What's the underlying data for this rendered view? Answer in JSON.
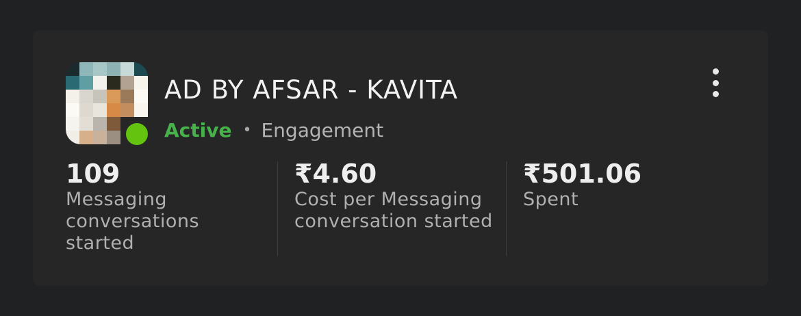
{
  "ad": {
    "title": "AD BY AFSAR - KAVITA",
    "status": "Active",
    "separator": "•",
    "objective": "Engagement",
    "status_color": "#63c30f"
  },
  "metrics": [
    {
      "value": "109",
      "label": "Messaging conversations started"
    },
    {
      "value": "₹4.60",
      "label": "Cost per Messaging conversation started"
    },
    {
      "value": "₹501.06",
      "label": "Spent"
    }
  ],
  "icons": {
    "menu": "more-vertical-icon"
  }
}
